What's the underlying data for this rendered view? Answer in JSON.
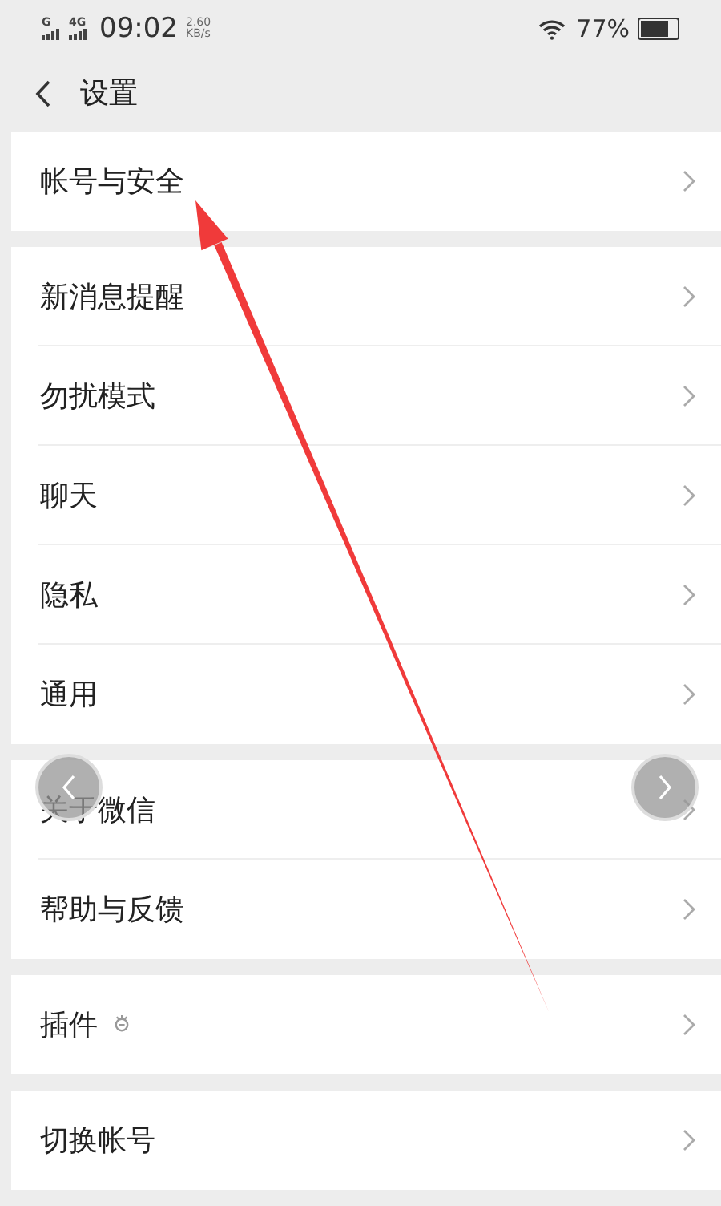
{
  "status_bar": {
    "sim1": "G",
    "sim2": "4G",
    "time": "09:02",
    "speed_value": "2.60",
    "speed_unit": "KB/s",
    "battery": "77%"
  },
  "header": {
    "title": "设置"
  },
  "groups": [
    {
      "items": [
        {
          "label": "帐号与安全",
          "kind": "plain"
        }
      ]
    },
    {
      "items": [
        {
          "label": "新消息提醒",
          "kind": "plain"
        },
        {
          "label": "勿扰模式",
          "kind": "plain"
        },
        {
          "label": "聊天",
          "kind": "plain"
        },
        {
          "label": "隐私",
          "kind": "plain"
        },
        {
          "label": "通用",
          "kind": "plain"
        }
      ]
    },
    {
      "items": [
        {
          "label": "关于微信",
          "kind": "plain"
        },
        {
          "label": "帮助与反馈",
          "kind": "plain"
        }
      ]
    },
    {
      "items": [
        {
          "label": "插件",
          "kind": "with-icon"
        }
      ]
    },
    {
      "items": [
        {
          "label": "切换帐号",
          "kind": "plain"
        }
      ]
    }
  ]
}
